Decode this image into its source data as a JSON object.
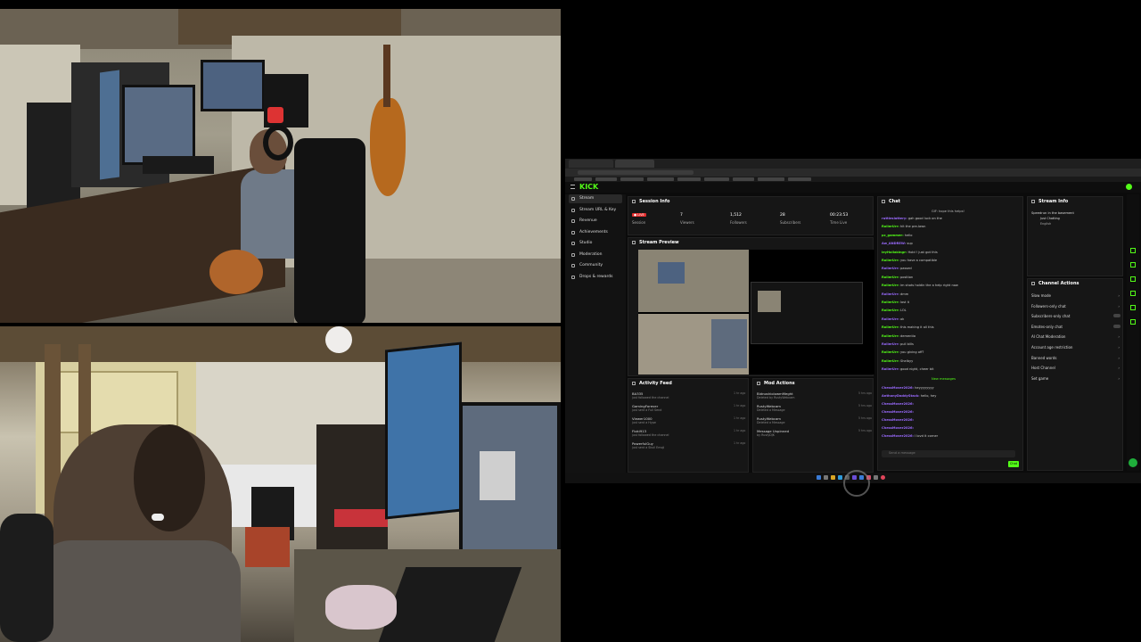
{
  "kick": {
    "logo": "KICK",
    "sidebar": [
      {
        "label": "Stream"
      },
      {
        "label": "Stream URL & Key"
      },
      {
        "label": "Revenue"
      },
      {
        "label": "Achievements"
      },
      {
        "label": "Studio"
      },
      {
        "label": "Moderation"
      },
      {
        "label": "Community"
      },
      {
        "label": "Drops & rewards"
      }
    ],
    "session": {
      "title": "Session Info",
      "live": "● LIVE",
      "stats": [
        {
          "value": "7",
          "label": "Viewers"
        },
        {
          "value": "1,512",
          "label": "Followers"
        },
        {
          "value": "28",
          "label": "Subscribers"
        },
        {
          "value": "00:23:53",
          "label": "Time Live"
        }
      ],
      "session_label": "Session"
    },
    "preview_title": "Stream Preview",
    "chat": {
      "title": "Chat",
      "pinned": "GIF: hope this helps!",
      "lines": [
        {
          "user": "ruttleslattery:",
          "msg": "gah good luck on the"
        },
        {
          "user": "RollerUrr:",
          "msg": "hit the pre-lawn"
        },
        {
          "user": "pc_gammer:",
          "msg": "hello"
        },
        {
          "user": "Aw_ANDREW:",
          "msg": "sup"
        },
        {
          "user": "leyHollakingr:",
          "msg": "Hold ! just got this"
        },
        {
          "user": "RollerUrr:",
          "msg": "you have a compatible"
        },
        {
          "user": "RollerUrr:",
          "msg": "passed"
        },
        {
          "user": "RollerUrr:",
          "msg": "position"
        },
        {
          "user": "RollerUrr:",
          "msg": "im shots holdin the a help right now"
        },
        {
          "user": "RollerUrr:",
          "msg": "dmm"
        },
        {
          "user": "RollerUrr:",
          "msg": "lost it"
        },
        {
          "user": "RollerUrr:",
          "msg": "LOL"
        },
        {
          "user": "RollerUrr:",
          "msg": "ok"
        },
        {
          "user": "RollerUrr:",
          "msg": "this making it all this"
        },
        {
          "user": "RollerUrr:",
          "msg": "dementia"
        },
        {
          "user": "RollerUrr:",
          "msg": "pull bills"
        },
        {
          "user": "RollerUrr:",
          "msg": "you giving off?"
        },
        {
          "user": "RollerUrr:",
          "msg": "Shelbyy"
        },
        {
          "user": "RollerUrr:",
          "msg": "good night, cheer bit"
        }
      ],
      "new_messages": "New messages",
      "lines2": [
        {
          "user": "ChessMover2026:",
          "msg": "heyyyyyyyy"
        },
        {
          "user": "AnthonyDaddyStack:",
          "msg": "hello, hey"
        },
        {
          "user": "ChessMover2026:",
          "msg": ""
        },
        {
          "user": "ChessMover2026:",
          "msg": ""
        },
        {
          "user": "ChessMover2026:",
          "msg": ""
        },
        {
          "user": "ChessMover2026:",
          "msg": ""
        },
        {
          "user": "ChessMover2026:",
          "msg": "I lovd it corner"
        }
      ],
      "input_placeholder": "Send a message",
      "send": "Chat"
    },
    "stream_info": {
      "title": "Stream Info",
      "stream_title": "Speedrun in the basement",
      "category": "Just Chatting",
      "language": "English"
    },
    "channel_actions": {
      "title": "Channel Actions",
      "items": [
        "Slow mode",
        "Followers-only chat",
        "Subscribers-only chat",
        "Emotes-only chat",
        "AI Chat Moderation",
        "Account age restriction",
        "Banned words",
        "Host Channel",
        "Set game"
      ]
    },
    "activity": {
      "title": "Activity Feed",
      "items": [
        {
          "name": "BA335",
          "sub": "just followed the channel",
          "time": "1 hr ago"
        },
        {
          "name": "GamingForever",
          "sub": "just sent a Full Send",
          "time": "1 hr ago"
        },
        {
          "name": "Viewer1000",
          "sub": "just sent a Hype",
          "time": "1 hr ago"
        },
        {
          "name": "Floki913",
          "sub": "just followed the channel",
          "time": "1 hr ago"
        },
        {
          "name": "PowerfulGuy",
          "sub": "just sent a Skull Emoji",
          "time": "1 hr ago"
        }
      ]
    },
    "mod": {
      "title": "Mod Actions",
      "items": [
        {
          "name": "BidnoshiolowmMeght",
          "sub": "Deleted by RustyWebcam",
          "time": "5 hrs ago"
        },
        {
          "name": "RustyWebcam",
          "sub": "Deleted a Message",
          "time": "5 hrs ago"
        },
        {
          "name": "RustyWebcam",
          "sub": "Deleted a Message",
          "time": "5 hrs ago"
        },
        {
          "name": "Message Unpinned",
          "sub": "by RustyDJK",
          "time": "5 hrs ago"
        }
      ]
    },
    "colors": {
      "accent": "#53fc18"
    }
  }
}
